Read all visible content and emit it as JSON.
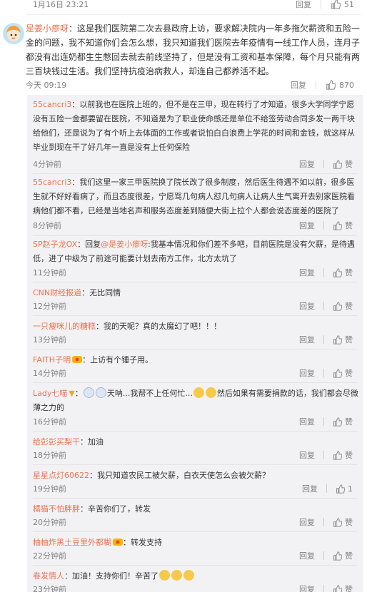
{
  "top_comment": {
    "time": "1月16日 23:21",
    "reply": "回复",
    "likes": "51"
  },
  "main": {
    "user": "是姜小瘆呀",
    "text": "：这是我们医院第二次去县政府上访，要求解决院内一年多拖欠薪资和五险一金的问题，我不知道你们会怎么想，我只知道我们医院去年疫情有一线工作人员，连月子都没有出连奶都生生憋回去就去前线坚持了，但是没有工资和基本保障，每个月只能有两三百块钱过生活。我们坚持抗疫治病救人，却连自己都养活不起。",
    "time": "今天 09:19",
    "reply": "回复",
    "likes": "870"
  },
  "replies": [
    {
      "user": "55cancri3",
      "text": "：以前我也在医院上班的，但不是在三甲，现在转行了才知道，很多大学同学宁愿没有五险一金都要留在医院，不知道是为了职业使命感还是单位不给签劳动合同多发一两千块给他们，还是说为了有个听上去体面的工作或者说怕白白浪费上学花的时间和金钱，就这样从毕业到现在干了好几年一直是没有上任何保险",
      "time": "4分钟前",
      "reply": "回复",
      "like": "赞"
    },
    {
      "user": "55cancri3",
      "text": "：我们这里一家三甲医院换了院长改了很多制度，然后医生待遇不如以前，很多医生就不好好看病了，而且态度很差，宁愿骂几句病人怼几句病人让病人生气离开去别家医院看病他们都不看，已经是当地名声和服务态度差到随便大街上拉个人都会说态度差的医院了",
      "time": "8分钟前",
      "reply": "回复",
      "like": "赞"
    },
    {
      "user": "SP赵子龙OX",
      "text": "：回复",
      "mention": "@是姜小瘆呀",
      "text2": ":我基本情况和你们差不多吧，目前医院是没有欠薪，是待遇低，进了中级为了前途可能要计划去南方工作，北方太坑了",
      "time": "11分钟前",
      "reply": "回复",
      "like": "赞"
    },
    {
      "user": "CNN财经报道",
      "text": "：无比同情",
      "time": "12分钟前",
      "reply": "回复",
      "like": "赞"
    },
    {
      "user": "一只瘦咪儿的糖糕",
      "text": "：我的天呢？真的太魔幻了吧！！！",
      "time": "13分钟前",
      "reply": "回复",
      "like": "赞"
    },
    {
      "user": "FAITH子明",
      "text": "：上访有个锤子用。",
      "time": "14分钟前",
      "reply": "回复",
      "like": "赞"
    },
    {
      "user": "Lady七喵",
      "text": "：",
      "text2": "天呐...我帮不上任何忙...",
      "text3": "然后如果有需要捐款的话，我们都会尽微薄之力的",
      "time": "16分钟前",
      "reply": "回复",
      "like": "赞"
    },
    {
      "user": "给彭彭买梨干",
      "text": "：加油",
      "time": "18分钟前",
      "reply": "回复",
      "like": "赞"
    },
    {
      "user": "星星点灯60622",
      "text": "：我只知道农民工被欠薪，白衣天使怎么会被欠薪？",
      "time": "19分钟前",
      "reply": "回复",
      "likes": "1"
    },
    {
      "user": "橘猫不怕胖胖",
      "text": "：辛苦你们了，转发",
      "time": "20分钟前",
      "reply": "回复",
      "like": "赞"
    },
    {
      "user": "柚柚炸黑土豆里外都糊",
      "text": "：转发支持",
      "time": "22分钟前",
      "reply": "回复",
      "like": "赞"
    },
    {
      "user": "卷发情人",
      "text": "：加油！支持你们！辛苦了",
      "time": "23分钟前",
      "reply": "回复",
      "like": "赞"
    }
  ]
}
